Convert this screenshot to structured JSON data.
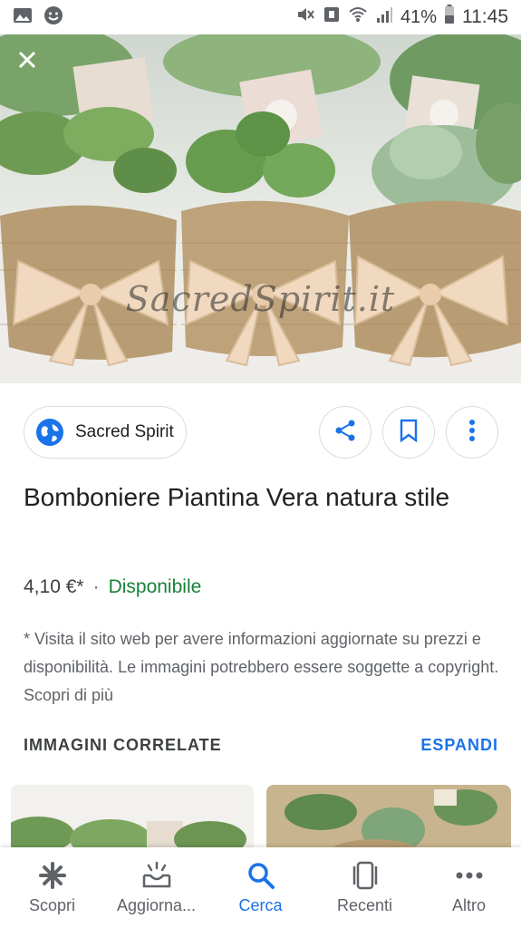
{
  "status_bar": {
    "battery_percent": "41%",
    "time": "11:45",
    "icons": [
      "gallery-icon",
      "face-icon",
      "mute-icon",
      "nfc-icon",
      "wifi-icon",
      "signal-icon",
      "battery-icon"
    ]
  },
  "hero": {
    "watermark": "SacredSpirit.it",
    "close_icon": "close-icon"
  },
  "source": {
    "name": "Sacred Spirit",
    "icon": "globe-icon"
  },
  "actions": {
    "share_icon": "share-icon",
    "save_icon": "bookmark-icon",
    "more_icon": "more-vert-icon"
  },
  "product": {
    "title": "Bomboniere Piantina Vera natura stile",
    "price": "4,10 €*",
    "separator": "·",
    "availability": "Disponibile"
  },
  "disclaimer": "* Visita il sito web per avere informazioni aggiornate su prezzi e disponibilità. Le immagini potrebbero essere soggette a copyright. Scopri di più",
  "related": {
    "title": "IMMAGINI CORRELATE",
    "expand": "ESPANDI"
  },
  "bottom_nav": {
    "items": [
      {
        "label": "Scopri",
        "icon": "asterisk-icon"
      },
      {
        "label": "Aggiorna...",
        "icon": "updates-icon"
      },
      {
        "label": "Cerca",
        "icon": "search-icon"
      },
      {
        "label": "Recenti",
        "icon": "recents-icon"
      },
      {
        "label": "Altro",
        "icon": "more-horiz-icon"
      }
    ],
    "active_index": 2
  },
  "colors": {
    "accent_blue": "#1a73e8",
    "availability_green": "#188038",
    "text_primary": "#202124",
    "text_secondary": "#5f6368",
    "border": "#dadce0"
  }
}
